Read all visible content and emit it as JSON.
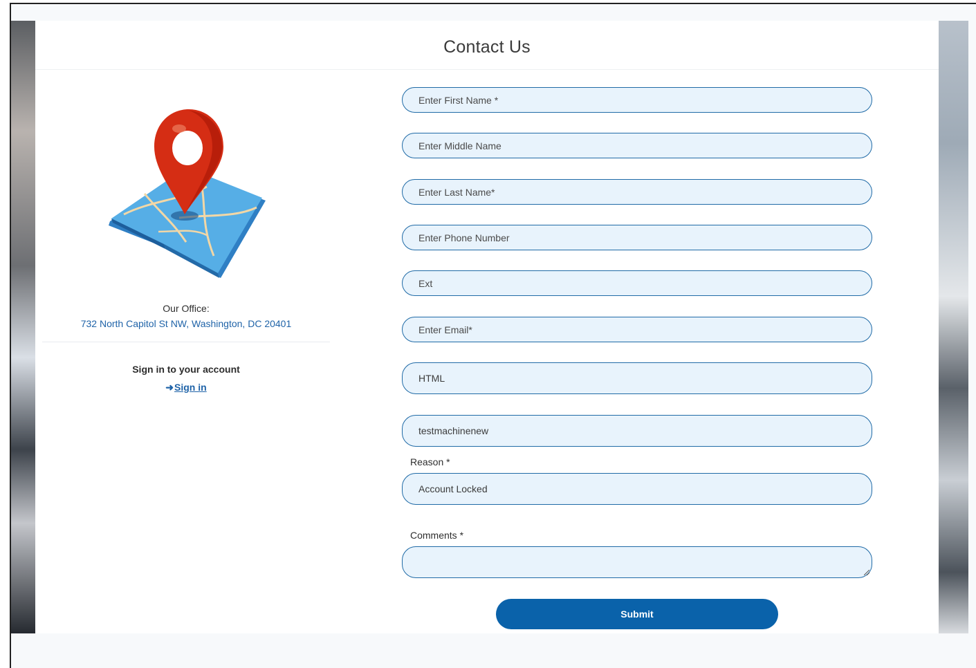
{
  "page": {
    "title": "Contact Us"
  },
  "office": {
    "label": "Our Office:",
    "address": "732 North Capitol St NW, Washington, DC 20401",
    "icon": "map-pin-icon"
  },
  "signin": {
    "title": "Sign in to your account",
    "link_label": "Sign in",
    "icon": "sign-in-arrow-icon"
  },
  "form": {
    "first_name": {
      "placeholder": "Enter First Name *",
      "value": ""
    },
    "middle_name": {
      "placeholder": "Enter Middle Name",
      "value": ""
    },
    "last_name": {
      "placeholder": "Enter Last Name*",
      "value": ""
    },
    "phone": {
      "placeholder": "Enter Phone Number",
      "value": ""
    },
    "ext": {
      "placeholder": "Ext",
      "value": ""
    },
    "email": {
      "placeholder": "Enter Email*",
      "value": ""
    },
    "html_field": {
      "value": "HTML"
    },
    "machine": {
      "value": "testmachinenew"
    },
    "reason": {
      "label": "Reason *",
      "value": "Account Locked"
    },
    "comments": {
      "label": "Comments *",
      "value": ""
    },
    "submit_label": "Submit"
  },
  "colors": {
    "accent": "#0a62aa",
    "field_bg": "#e8f3fc",
    "field_border": "#1f6aa6",
    "link": "#1f63a8"
  }
}
